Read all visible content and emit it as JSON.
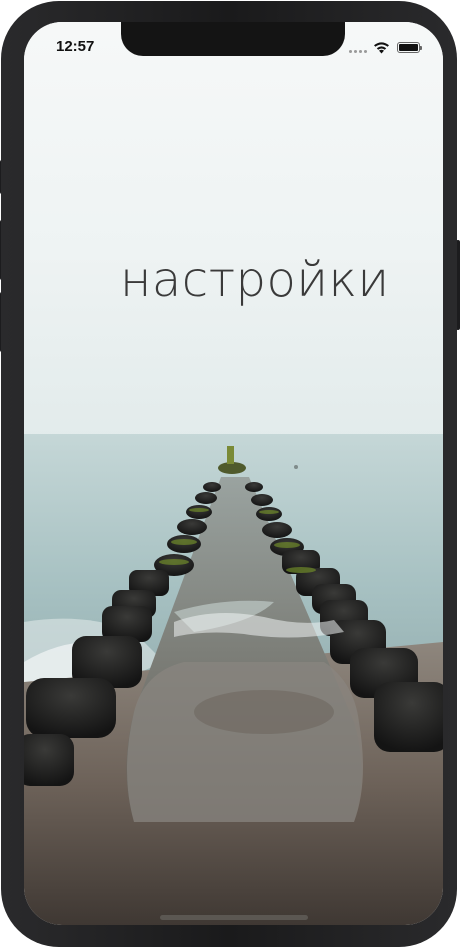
{
  "status_bar": {
    "time": "12:57",
    "signal_icon": "cellular-signal-icon",
    "wifi_icon": "wifi-icon",
    "battery_icon": "battery-icon",
    "battery_level": 1.0
  },
  "main": {
    "title": "настройки",
    "background_image": "sea-breakwater-photo"
  },
  "colors": {
    "sky": "#f2f6f6",
    "sea": "#a9c3c4",
    "sand": "#6f6359",
    "title_text": "#3a3a3a",
    "frame": "#1e1e20"
  }
}
